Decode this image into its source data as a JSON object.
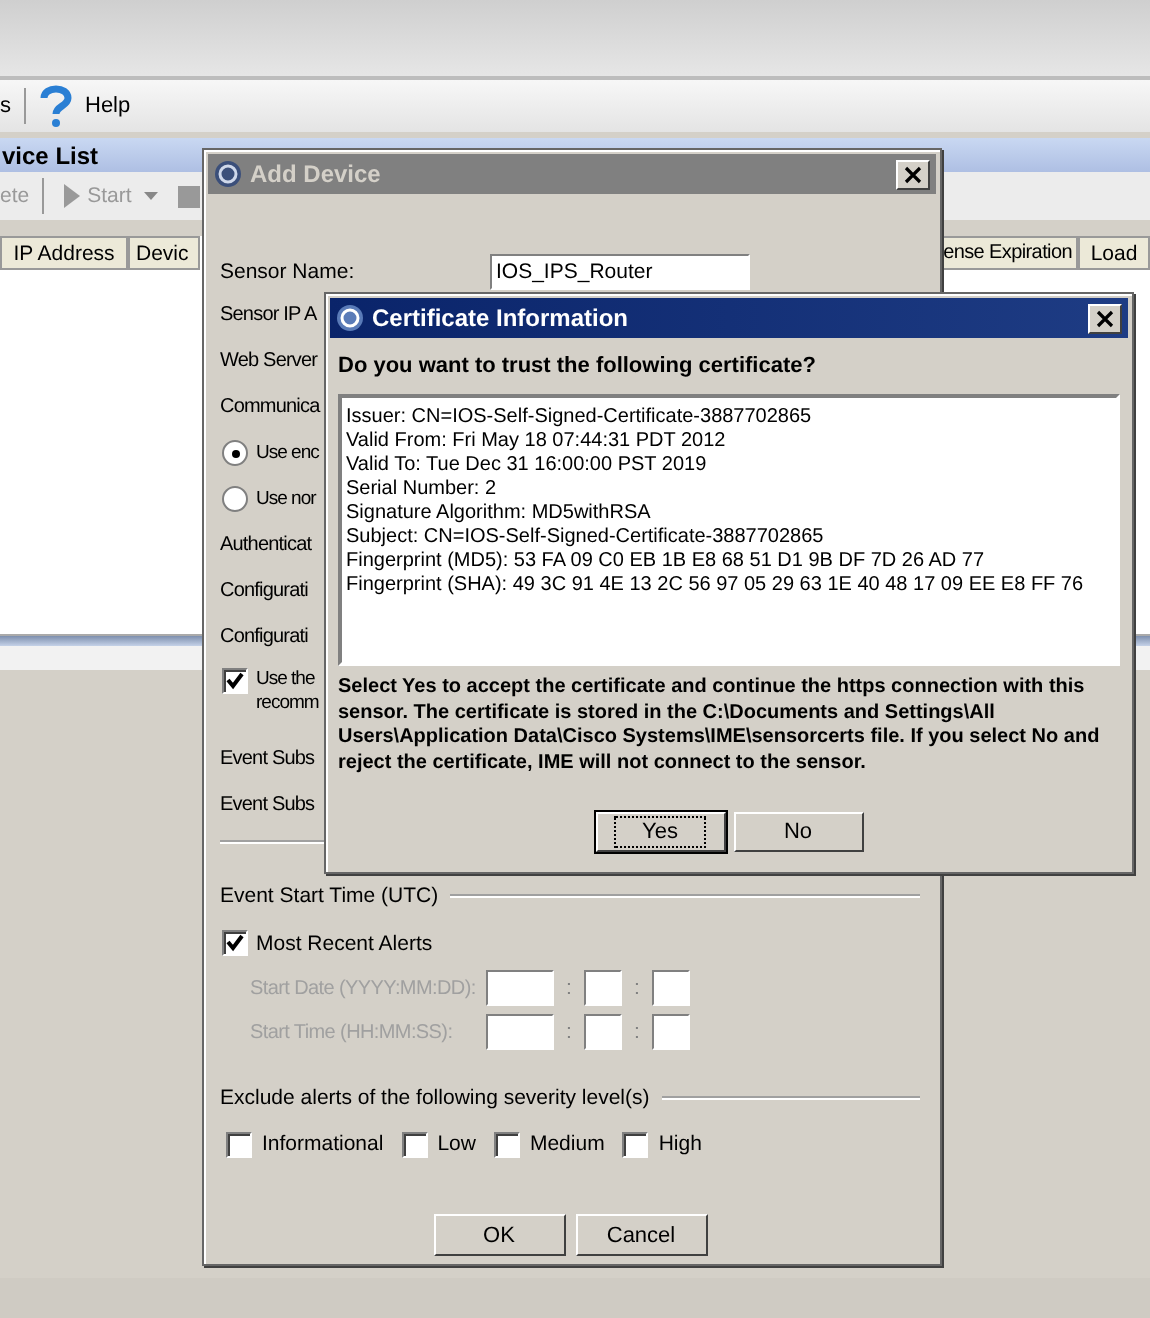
{
  "app": {
    "toolbar": {
      "cut_item": "s",
      "help": "Help"
    },
    "panel_title": "vice List",
    "actions": [
      {
        "kind": "text",
        "label": "ete"
      },
      {
        "kind": "play",
        "label": "Start"
      },
      {
        "kind": "stop"
      }
    ],
    "columns": [
      "IP Address",
      "Devic",
      "ense Expiration",
      "Load"
    ]
  },
  "add_device": {
    "title": "Add Device",
    "sensor_name_label": "Sensor Name:",
    "sensor_name": "IOS_IPS_Router",
    "rows": [
      {
        "kind": "label",
        "text": "Sensor IP A"
      },
      {
        "kind": "label",
        "text": "Web Server"
      },
      {
        "kind": "label",
        "text": "Communica"
      },
      {
        "kind": "radio",
        "text": "Use enc",
        "selected": true
      },
      {
        "kind": "radio",
        "text": "Use nor",
        "selected": false
      },
      {
        "kind": "label",
        "text": "Authenticat"
      },
      {
        "kind": "label",
        "text": "Configurati"
      },
      {
        "kind": "label",
        "text": "Configurati"
      },
      {
        "kind": "checkbox",
        "lines": [
          "Use the",
          "recomm"
        ],
        "checked": true
      },
      {
        "kind": "label",
        "text": "Event Subs"
      },
      {
        "kind": "label",
        "text": "Event Subs"
      }
    ],
    "start_time": {
      "heading": "Event Start Time (UTC)",
      "most_recent": {
        "label": "Most Recent Alerts",
        "checked": true
      },
      "date_label": "Start Date (YYYY:MM:DD):",
      "time_label": "Start Time (HH:MM:SS):",
      "separator": ":",
      "disabled": true
    },
    "severity": {
      "heading": "Exclude alerts of the following severity level(s)",
      "levels": [
        {
          "label": "Informational",
          "checked": false
        },
        {
          "label": "Low",
          "checked": false
        },
        {
          "label": "Medium",
          "checked": false
        },
        {
          "label": "High",
          "checked": false
        }
      ]
    },
    "buttons": [
      "OK",
      "Cancel"
    ]
  },
  "certificate": {
    "title": "Certificate Information",
    "question": "Do you want to trust the following certificate?",
    "details": [
      "Issuer: CN=IOS-Self-Signed-Certificate-3887702865",
      "Valid From: Fri May 18 07:44:31 PDT 2012",
      "Valid To: Tue Dec 31 16:00:00 PST 2019",
      "Serial Number: 2",
      "Signature Algorithm: MD5withRSA",
      "Subject: CN=IOS-Self-Signed-Certificate-3887702865",
      "Fingerprint (MD5): 53 FA 09 C0 EB 1B E8 68 51 D1 9B DF 7D 26 AD 77",
      "Fingerprint (SHA): 49 3C 91 4E 13 2C 56 97 05 29 63 1E 40 48 17 09 EE E8 FF 76"
    ],
    "message": "Select Yes to accept the certificate and continue the https connection with this sensor. The certificate is stored in the C:\\Documents and Settings\\All Users\\Application Data\\Cisco Systems\\IME\\sensorcerts file. If you select No and reject the certificate, IME will not connect to the sensor.",
    "buttons": [
      {
        "label": "Yes",
        "focused": true
      },
      {
        "label": "No",
        "focused": false
      }
    ]
  }
}
